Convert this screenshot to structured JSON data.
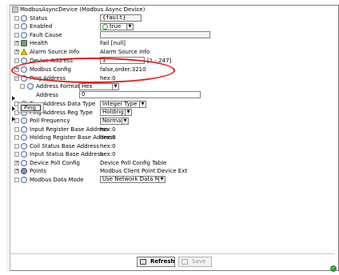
{
  "header": {
    "title": "ModbusAsyncDevice  (Modbus Async Device)"
  },
  "rows": {
    "status": {
      "label": "Status",
      "value": "{fault}"
    },
    "enabled": {
      "label": "Enabled",
      "value": "true"
    },
    "fault_cause": {
      "label": "Fault Cause",
      "value": ""
    },
    "health": {
      "label": "Health",
      "value": "Fail [null]"
    },
    "alarm_source": {
      "label": "Alarm Source Info",
      "value": "Alarm Source Info"
    },
    "device_address": {
      "label": "Device Address",
      "value": "1",
      "range": "[1 - 247]"
    },
    "modbus_config": {
      "label": "Modbus Config",
      "value": "false,order:3210"
    },
    "ping_address": {
      "label": "Ping Address",
      "value": "hex:0"
    },
    "address_format": {
      "label": "Address Format",
      "value": "Hex"
    },
    "address": {
      "label": "Address",
      "value": "0"
    },
    "ping_data_type": {
      "label": "Ping Address Data Type",
      "value": "Integer Type"
    },
    "ping_reg_type": {
      "label": "Ping Address Reg Type",
      "value": "Holding"
    },
    "poll_frequency": {
      "label": "Poll Frequency",
      "value": "Normal"
    },
    "input_reg_base": {
      "label": "Input Register Base Address",
      "value": "hex:0"
    },
    "holding_reg_base": {
      "label": "Holding Register Base Address",
      "value": "hex:0"
    },
    "coil_status_base": {
      "label": "Coil Status Base Address",
      "value": "hex:0"
    },
    "input_status_base": {
      "label": "Input Status Base Address",
      "value": "hex:0"
    },
    "device_poll_config": {
      "label": "Device Poll Config",
      "value": "Device Poll Config Table"
    },
    "points": {
      "label": "Points",
      "value": "Modbus Client Point Device Ext"
    },
    "data_mode": {
      "label": "Modbus Data Mode",
      "value": "Use Network Data Mode"
    }
  },
  "side_popup": {
    "label": "Ping"
  },
  "buttons": {
    "refresh": "Refresh",
    "save": "Save"
  },
  "colors": {
    "callout": "#e01b1b",
    "ok": "#2e9a3a"
  },
  "icons": {
    "status": "circle-icon",
    "health": "health-icon",
    "points": "points-icon",
    "ok": "check-circle-icon",
    "expand": "expand-icon"
  }
}
